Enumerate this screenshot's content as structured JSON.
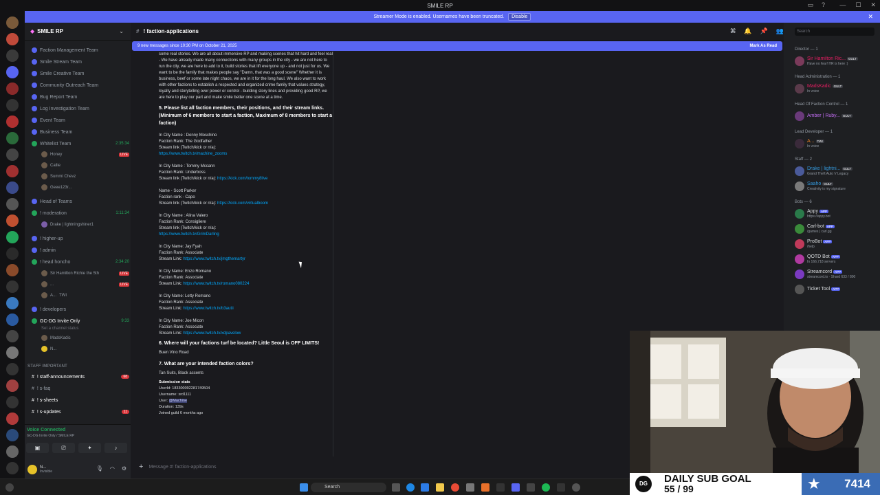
{
  "window": {
    "title": "SMILE RP"
  },
  "banner": {
    "text": "Streamer Mode is enabled. Usernames have been truncated.",
    "disable_label": "Disable"
  },
  "server": {
    "name": "SMILE RP"
  },
  "channels": {
    "categories": [
      "Faction Management Team",
      "Smile Stream Team",
      "Smile Creative Team",
      "Community Outreach Team",
      "Bug Report Team",
      "Log Investigation Team",
      "Event Team",
      "Business Team"
    ],
    "whitelist": {
      "name": "Whitelist Team",
      "time": "2:35:34",
      "users": [
        "Honey",
        "Callie",
        "Summi Chevz",
        "Geee123r..."
      ],
      "live_label": "LIVE"
    },
    "head_of_teams": "Head of Teams",
    "moderation": {
      "name": "! moderation",
      "time": "1:11:34",
      "user": "Drake | lightningshiner1"
    },
    "higher_up": "! higher-up",
    "admin": "! admin",
    "head_honcho": {
      "name": "! head honcho",
      "time": "2:34:20",
      "users": [
        "Sir Hamilton Richie the 5th",
        "...",
        "A..."
      ],
      "tag": "TWI"
    },
    "developers": "! developers",
    "gcdg": {
      "name": "GC-DG Invite Only",
      "time": "9:33",
      "sub": "Set a channel status",
      "users": [
        "MadsKadic",
        "N..."
      ]
    },
    "staff_cat": "STAFF IMPORTANT",
    "staff": [
      {
        "name": "! staff-announcements",
        "count": "68"
      },
      {
        "name": "! s-faq",
        "count": ""
      },
      {
        "name": "! s-sheets",
        "count": ""
      },
      {
        "name": "! s-updates",
        "count": "11"
      }
    ]
  },
  "voice": {
    "status": "Voice Connected",
    "sub": "GC-DG Invite Only / SMILE RP"
  },
  "self": {
    "name": "N...",
    "status": "Invisible"
  },
  "chat": {
    "channel": "! faction-applications",
    "new_messages": "9 new messages since 10:30 PM on October 21, 2025",
    "mark_as_read": "Mark As Read",
    "intro": "some real stories. We are all about immersive RP and making scenes that hit hard and feel real - We have already made many connections with many groups in the city - we are not here to run the city, we are here to add to it, build stories that lift everyone up - and not just for us. We want to be the family that makes people say \"Damn, that was a good scene\" Whether it is business, beef or some late night chaos, we are in it for the long haul. We also want to work with other factions to establish a respected and organized crime family that values strategy, loyalty and storytelling over power or control - building story lines and providing good RP, we are here to play our part and make smile better one scene at a time.",
    "q5": "5. Please list all faction members, their positions, and their stream links. (Minimum of 6 members to start a faction, Maximum of 8 members to start a faction)",
    "members": [
      {
        "l1": "In City Name : Donny Moschino",
        "l2": "Faction Rank: The Godfather",
        "l3": "Stream link (Twitch/kick or n/a):",
        "link": "https://www.twitch.tv/machine_zooms"
      },
      {
        "l1": "In City Name : Tommy Mccann",
        "l2": "Faction Rank: Underboss",
        "l3": "Stream link (Twitch/kick or n/a):",
        "link": "https://kick.com/tommy8live"
      },
      {
        "l1": "Name - Scott Parker",
        "l2": "Faction rank - Capo",
        "l3": "Stream link (Twitch/kick or n/a):",
        "link": "https://kick.com/virtualboom"
      },
      {
        "l1": "In City Name : Alina Valero",
        "l2": "Faction Rank: Consigliere",
        "l3": "Stream link (Twitch/kick or n/a):",
        "link": "https://www.twitch.tv/GrimDarling"
      },
      {
        "l1": "In City Name: Jay Fyah",
        "l2": "Faction Rank: Associate",
        "l3": "Stream Link:",
        "link": "https://www.twitch.tv/jmgthemartyr"
      },
      {
        "l1": "In City Name: Enzo Romano",
        "l2": "Faction Rank: Associate",
        "l3": "Stream Link:",
        "link": "https://www.twitch.tv/romano080224"
      },
      {
        "l1": "In City Name: Letty Romano",
        "l2": "Faction Rank: Associate",
        "l3": "Stream Link:",
        "link": "https://www.twitch.tv/b3autii"
      },
      {
        "l1": "In City Name: Joe Micon",
        "l2": "Faction Rank: Associate",
        "l3": "Stream Link:",
        "link": "https://www.twitch.tv/xdpavelow"
      }
    ],
    "q6": "6. Where will your factions turf be located? Little Seoul is OFF LIMITS!",
    "a6": "Buen Vino Road",
    "q7": "7. What are your intended faction colors?",
    "a7": "Tan Suits, Black accents",
    "stats_title": "Submission stats",
    "stats": [
      {
        "k": "UserId: ",
        "v": "183300092281749504"
      },
      {
        "k": "Username: ",
        "v": "xrd1111"
      },
      {
        "k": "User: ",
        "v": "@Machine"
      },
      {
        "k": "Duration: ",
        "v": "139s"
      },
      {
        "k": "Joined guild ",
        "v": "6 months ago"
      }
    ],
    "composer_placeholder": "Message #! faction-applications"
  },
  "members_list": {
    "search_placeholder": "Search",
    "groups": [
      {
        "role": "Director — 1",
        "members": [
          {
            "name": "Sir Hamilton Ric...",
            "status": "Have no fear! HR is here :)",
            "color": "#e91e63",
            "tag": "GULT"
          }
        ]
      },
      {
        "role": "Head Administration — 1",
        "members": [
          {
            "name": "MadsKadic",
            "status": "In voice",
            "color": "#e91e63",
            "tag": "GULT"
          }
        ]
      },
      {
        "role": "Head Of Faction Control — 1",
        "members": [
          {
            "name": "Amber | Ruby...",
            "status": "",
            "color": "#c06cf0",
            "tag": "GULT"
          }
        ]
      },
      {
        "role": "Lead Developer — 1",
        "members": [
          {
            "name": "A...",
            "status": "In voice",
            "color": "#e67e22",
            "tag": "TWI"
          }
        ]
      },
      {
        "role": "Staff — 2",
        "members": [
          {
            "name": "Drake | lightni...",
            "status": "Grand Theft Auto V Legacy",
            "color": "#3498db",
            "tag": "GULT"
          },
          {
            "name": "Saaho",
            "status": "Creativity is my signature",
            "color": "#3498db",
            "tag": "GULT"
          }
        ]
      },
      {
        "role": "Bots — 6",
        "members": [
          {
            "name": "Appy",
            "status": "https://appy.bot",
            "color": "#dbdee1",
            "tag": "APP"
          },
          {
            "name": "Carl-bot",
            "status": "/games | carl.gg",
            "color": "#dbdee1",
            "tag": "APP"
          },
          {
            "name": "ProBot",
            "status": "/help",
            "color": "#dbdee1",
            "tag": "APP"
          },
          {
            "name": "QOTD Bot",
            "status": "In 166,718 servers",
            "color": "#dbdee1",
            "tag": "APP"
          },
          {
            "name": "Streamcord",
            "status": "streamcord.io · Shard 633 / 800",
            "color": "#dbdee1",
            "tag": "APP"
          },
          {
            "name": "Ticket Tool",
            "status": "",
            "color": "#dbdee1",
            "tag": "APP"
          }
        ]
      }
    ]
  },
  "overlay": {
    "goal_label": "DAILY SUB GOAL",
    "goal_progress": "55 / 99",
    "count": "7414",
    "logo": "DG"
  },
  "taskbar": {
    "search": "Search"
  },
  "colors": {
    "accent": "#5865f2",
    "live": "#da373c",
    "online": "#23a55a",
    "link": "#00a8fc"
  }
}
